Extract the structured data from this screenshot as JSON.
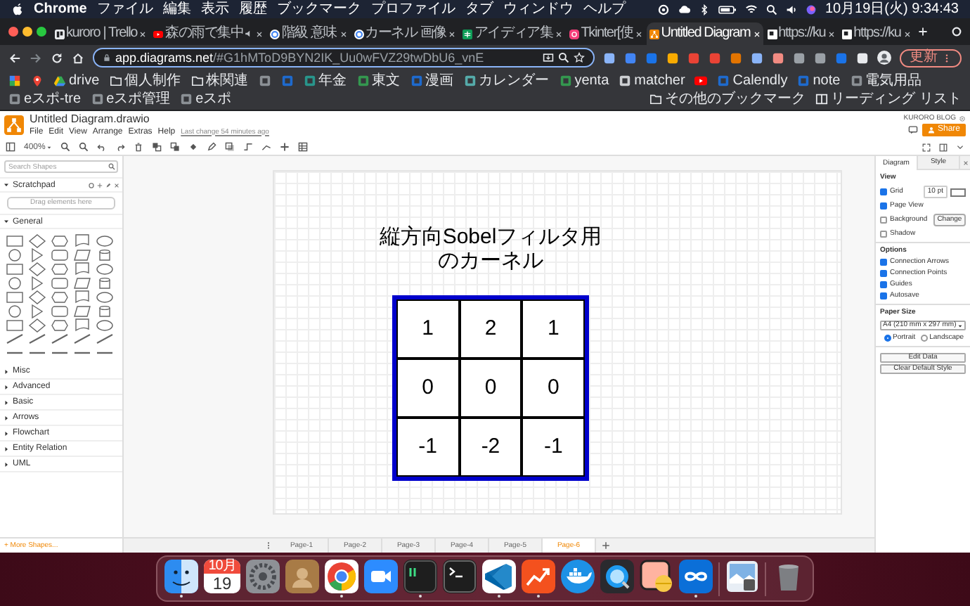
{
  "menu_bar": {
    "app": "Chrome",
    "items": [
      "ファイル",
      "編集",
      "表示",
      "履歴",
      "ブックマーク",
      "プロファイル",
      "タブ",
      "ウィンドウ",
      "ヘルプ"
    ],
    "clock": "10月19日(火) 9:34:43"
  },
  "browser_tabs": [
    {
      "kind": "board",
      "title": "kuroro | Trello",
      "selected": false,
      "audio": false
    },
    {
      "kind": "video",
      "title": "森の雨で集中",
      "selected": false,
      "audio": true
    },
    {
      "kind": "ring",
      "title": "階級 意味",
      "selected": false,
      "audio": false
    },
    {
      "kind": "ring",
      "title": "カーネル 画像",
      "selected": false,
      "audio": false
    },
    {
      "kind": "sheet",
      "title": "アイディア集",
      "selected": false,
      "audio": false
    },
    {
      "kind": "app",
      "title": "Tkinter[使",
      "selected": false,
      "audio": false
    },
    {
      "kind": "diagram",
      "title": "Untitled Diagram",
      "selected": true,
      "audio": false
    },
    {
      "kind": "page",
      "title": "https://ku",
      "selected": false,
      "audio": false
    },
    {
      "kind": "page",
      "title": "https://ku",
      "selected": false,
      "audio": false
    }
  ],
  "address_bar": {
    "host": "app.diagrams.net",
    "path": "/#G1hMToD9BYN2IK_Uu0wFVZ29twDbU6_vnE",
    "update_button": "更新"
  },
  "bookmarks": [
    {
      "kind": "multicolor"
    },
    {
      "kind": "map"
    },
    {
      "kind": "drive",
      "label": "drive"
    },
    {
      "kind": "folder",
      "label": "個人制作"
    },
    {
      "kind": "folder",
      "label": "株関連"
    },
    {
      "kind": "site"
    },
    {
      "kind": "site"
    },
    {
      "kind": "site",
      "label": "年金"
    },
    {
      "kind": "site",
      "label": "東文"
    },
    {
      "kind": "site",
      "label": "漫画"
    },
    {
      "kind": "site",
      "label": "カレンダー"
    },
    {
      "kind": "site",
      "label": "yenta"
    },
    {
      "kind": "site",
      "label": "matcher"
    },
    {
      "kind": "video"
    },
    {
      "kind": "site",
      "label": "Calendly"
    },
    {
      "kind": "site",
      "label": "note"
    },
    {
      "kind": "site",
      "label": "電気用品"
    },
    {
      "kind": "site",
      "label": "eスポ-tre"
    },
    {
      "kind": "site",
      "label": "eスポ管理"
    },
    {
      "kind": "site",
      "label": "eスポ"
    }
  ],
  "bookmarks_right": [
    {
      "kind": "folder",
      "label": "その他のブックマーク"
    },
    {
      "kind": "reading",
      "label": "リーディング リスト"
    }
  ],
  "drawio": {
    "file_name": "Untitled Diagram.drawio",
    "menus": [
      "File",
      "Edit",
      "View",
      "Arrange",
      "Extras",
      "Help"
    ],
    "last_change": "Last change 54 minutes ago",
    "user": "KURORO BLOG",
    "share": "Share",
    "zoom": "400%"
  },
  "sidebar": {
    "search_placeholder": "Search Shapes",
    "scratchpad": {
      "title": "Scratchpad",
      "expanded": true,
      "hint": "Drag elements here"
    },
    "general": {
      "title": "General",
      "expanded": true
    },
    "sections": [
      {
        "title": "Misc",
        "expanded": false
      },
      {
        "title": "Advanced",
        "expanded": false
      },
      {
        "title": "Basic",
        "expanded": false
      },
      {
        "title": "Arrows",
        "expanded": false
      },
      {
        "title": "Flowchart",
        "expanded": false
      },
      {
        "title": "Entity Relation",
        "expanded": false
      },
      {
        "title": "UML",
        "expanded": false
      }
    ],
    "more_shapes": "+ More Shapes..."
  },
  "diagram": {
    "title_lines": [
      "縦方向Sobelフィルタ用",
      "のカーネル"
    ],
    "kernel": [
      [
        "1",
        "2",
        "1"
      ],
      [
        "0",
        "0",
        "0"
      ],
      [
        "-1",
        "-2",
        "-1"
      ]
    ]
  },
  "format_panel": {
    "tabs": [
      {
        "label": "Diagram",
        "selected": true
      },
      {
        "label": "Style",
        "selected": false
      }
    ],
    "view": {
      "title": "View",
      "items": [
        {
          "label": "Grid",
          "checked": true
        },
        {
          "label": "Page View",
          "checked": true
        },
        {
          "label": "Background",
          "checked": false
        },
        {
          "label": "Shadow",
          "checked": false
        }
      ],
      "grid_size": "10 pt",
      "change_button": "Change"
    },
    "options": {
      "title": "Options",
      "items": [
        {
          "label": "Connection Arrows",
          "checked": true
        },
        {
          "label": "Connection Points",
          "checked": true
        },
        {
          "label": "Guides",
          "checked": true
        },
        {
          "label": "Autosave",
          "checked": true
        }
      ]
    },
    "paper_size": {
      "title": "Paper Size",
      "value": "A4 (210 mm x 297 mm)",
      "orientations": [
        {
          "label": "Portrait",
          "selected": true
        },
        {
          "label": "Landscape",
          "selected": false
        }
      ]
    },
    "buttons": [
      "Edit Data",
      "Clear Default Style"
    ]
  },
  "pages": [
    {
      "label": "Page-1",
      "selected": false
    },
    {
      "label": "Page-2",
      "selected": false
    },
    {
      "label": "Page-3",
      "selected": false
    },
    {
      "label": "Page-4",
      "selected": false
    },
    {
      "label": "Page-5",
      "selected": false
    },
    {
      "label": "Page-6",
      "selected": true
    }
  ],
  "dock": {
    "apps": [
      {
        "kind": "finder",
        "running": true
      },
      {
        "kind": "calendar",
        "month": "10月",
        "day": "19",
        "running": false
      },
      {
        "kind": "gear",
        "running": false
      },
      {
        "kind": "contacts",
        "running": false
      },
      {
        "kind": "tricolor",
        "running": true
      },
      {
        "kind": "camera",
        "running": false
      },
      {
        "kind": "terminal_green",
        "running": true
      },
      {
        "kind": "terminal",
        "running": false
      },
      {
        "kind": "editor",
        "running": true
      },
      {
        "kind": "trend",
        "running": true
      },
      {
        "kind": "whale",
        "running": false
      },
      {
        "kind": "lens",
        "running": false
      },
      {
        "kind": "pill",
        "running": false
      },
      {
        "kind": "infinity",
        "running": true
      },
      {
        "kind": "separator"
      },
      {
        "kind": "stack",
        "running": false
      },
      {
        "kind": "separator"
      },
      {
        "kind": "trash",
        "running": false
      }
    ]
  }
}
